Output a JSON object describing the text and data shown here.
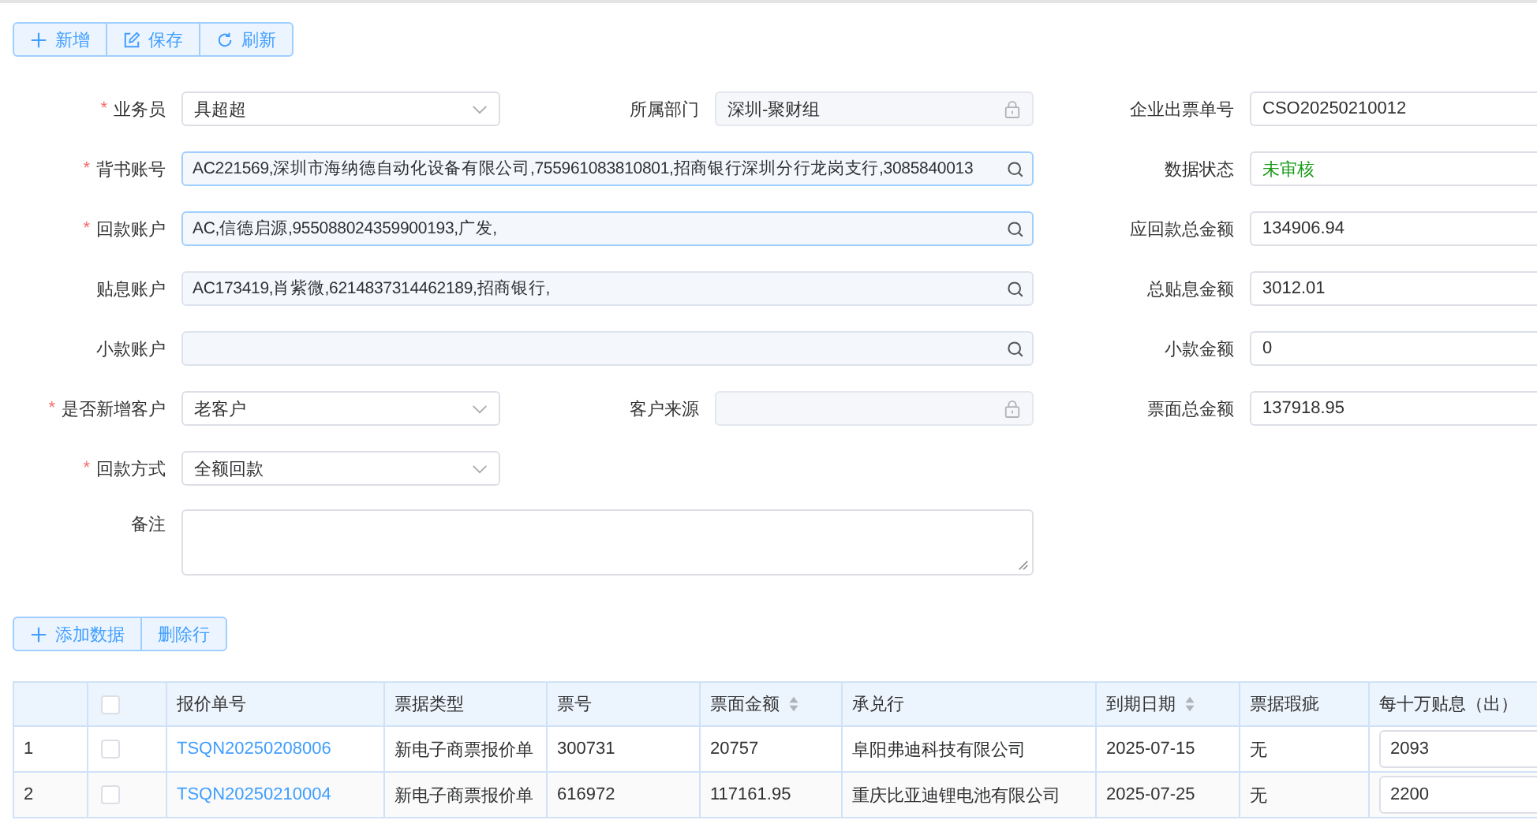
{
  "toolbar": [
    {
      "label": "新增"
    },
    {
      "label": "保存"
    },
    {
      "label": "刷新"
    }
  ],
  "form": {
    "rows": [
      {
        "left": {
          "label": "业务员",
          "required_mark": "*",
          "kind": "select",
          "value": "具超超"
        },
        "middle": {
          "label": "所属部门",
          "kind": "locked",
          "value": "深圳-聚财组"
        },
        "right": {
          "label": "企业出票单号",
          "kind": "text",
          "value": "CSO20250210012"
        }
      },
      {
        "left": {
          "label": "背书账号",
          "required_mark": "*",
          "kind": "search",
          "focused": true,
          "value": "AC221569,深圳市海纳德自动化设备有限公司,755961083810801,招商银行深圳分行龙岗支行,3085840013"
        },
        "right": {
          "label": "数据状态",
          "kind": "status",
          "value": "未审核"
        }
      },
      {
        "left": {
          "label": "回款账户",
          "required_mark": "*",
          "kind": "search",
          "focused": true,
          "value": "AC,信德启源,955088024359900193,广发,"
        },
        "right": {
          "label": "应回款总金额",
          "kind": "text",
          "value": "134906.94"
        }
      },
      {
        "left": {
          "label": "贴息账户",
          "kind": "search",
          "focused": false,
          "value": "AC173419,肖紫微,6214837314462189,招商银行,"
        },
        "right": {
          "label": "总贴息金额",
          "kind": "text",
          "value": "3012.01"
        }
      },
      {
        "left": {
          "label": "小款账户",
          "kind": "search",
          "focused": false
        },
        "right": {
          "label": "小款金额",
          "kind": "text",
          "value": "0"
        }
      },
      {
        "left": {
          "label": "是否新增客户",
          "required_mark": "*",
          "kind": "select",
          "value": "老客户"
        },
        "middle": {
          "label": "客户来源",
          "kind": "locked"
        },
        "right": {
          "label": "票面总金额",
          "kind": "text",
          "value": "137918.95"
        }
      },
      {
        "left": {
          "label": "回款方式",
          "required_mark": "*",
          "kind": "select",
          "value": "全额回款"
        }
      },
      {
        "left": {
          "label": "备注",
          "kind": "textarea"
        }
      }
    ]
  },
  "table_toolbar": [
    {
      "label": "添加数据"
    },
    {
      "label": "删除行"
    }
  ],
  "table": {
    "columns": [
      {
        "kind": "index"
      },
      {
        "kind": "check",
        "checked": false
      },
      {
        "label": "报价单号",
        "sortable": false
      },
      {
        "label": "票据类型",
        "sortable": false
      },
      {
        "label": "票号",
        "sortable": false
      },
      {
        "label": "票面金额",
        "sortable": true
      },
      {
        "label": "承兑行",
        "sortable": false
      },
      {
        "label": "到期日期",
        "sortable": true
      },
      {
        "label": "票据瑕疵",
        "sortable": false
      },
      {
        "label": "每十万贴息（出）",
        "sortable": false
      }
    ],
    "rows": [
      {
        "index": "1",
        "checked": false,
        "quote_no": "TSQN20250208006",
        "bill_type": "新电子商票报价单",
        "bill_no": "300731",
        "face_amount": "20757",
        "acceptor": "阜阳弗迪科技有限公司",
        "due_date": "2025-07-15",
        "defect": "无",
        "interest_per_100k": "2093"
      },
      {
        "index": "2",
        "checked": false,
        "quote_no": "TSQN20250210004",
        "bill_type": "新电子商票报价单",
        "bill_no": "616972",
        "face_amount": "117161.95",
        "acceptor": "重庆比亚迪锂电池有限公司",
        "due_date": "2025-07-25",
        "defect": "无",
        "interest_per_100k": "2200"
      }
    ]
  }
}
